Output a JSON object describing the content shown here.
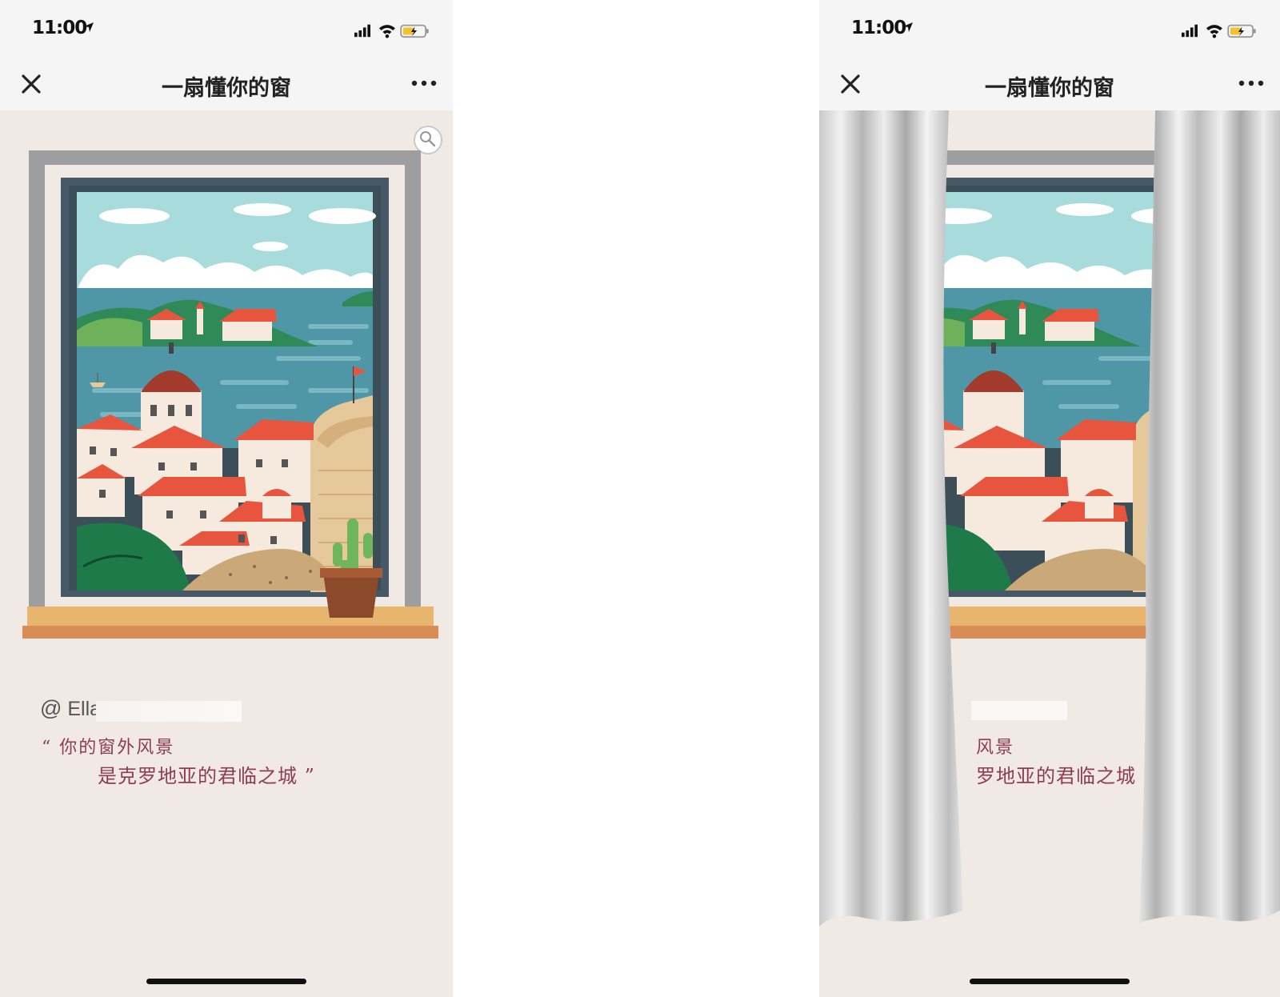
{
  "left_screen": {
    "status": {
      "time": "11:00"
    },
    "nav": {
      "title": "一扇懂你的窗"
    },
    "card": {
      "at_symbol": "@",
      "user_name": "Ella",
      "quote_line1": "“ 你的窗外风景",
      "quote_line2": "是克罗地亚的君临之城 ”"
    }
  },
  "right_screen": {
    "status": {
      "time": "11:00"
    },
    "nav": {
      "title": "一扇懂你的窗"
    },
    "card": {
      "quote_line1_partial": "风景",
      "quote_line2_partial": "罗地亚的君临之城"
    }
  },
  "icons": {
    "close": "close-icon",
    "more": "more-icon",
    "location": "location-arrow-icon",
    "signal": "signal-icon",
    "wifi": "wifi-icon",
    "battery": "battery-icon",
    "scope": "magnifier-icon"
  },
  "colors": {
    "page_bg": "#f1e9e4",
    "header_bg": "#f5f5f5",
    "quote_text": "#8e3d4d",
    "window_frame": "#455a66",
    "wall_frame": "#9c9ea0",
    "sill": "#e8b56f",
    "sea": "#4f96a6",
    "sky": "#a8dcdc",
    "roof_red": "#e8553f"
  }
}
